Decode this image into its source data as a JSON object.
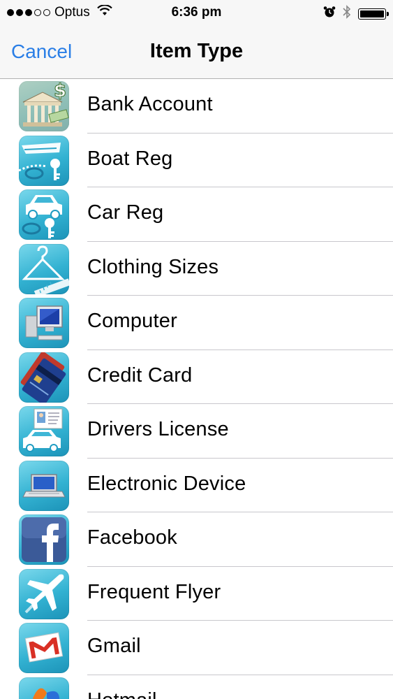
{
  "status_bar": {
    "carrier": "Optus",
    "signal_bars_filled": 3,
    "signal_bars_total": 5,
    "time": "6:36 pm",
    "icons": [
      "wifi-icon",
      "alarm-icon",
      "bluetooth-icon",
      "battery-icon"
    ]
  },
  "nav": {
    "cancel_label": "Cancel",
    "title": "Item Type",
    "accent_color": "#2a7ee6"
  },
  "items": [
    {
      "label": "Bank Account",
      "icon": "bank-icon"
    },
    {
      "label": "Boat Reg",
      "icon": "boat-key-icon"
    },
    {
      "label": "Car Reg",
      "icon": "car-key-icon"
    },
    {
      "label": "Clothing Sizes",
      "icon": "hanger-icon"
    },
    {
      "label": "Computer",
      "icon": "computer-icon"
    },
    {
      "label": "Credit Card",
      "icon": "credit-card-icon"
    },
    {
      "label": "Drivers License",
      "icon": "drivers-license-icon"
    },
    {
      "label": "Electronic Device",
      "icon": "laptop-icon"
    },
    {
      "label": "Facebook",
      "icon": "facebook-icon"
    },
    {
      "label": "Frequent Flyer",
      "icon": "airplane-icon"
    },
    {
      "label": "Gmail",
      "icon": "gmail-icon"
    },
    {
      "label": "Hotmail",
      "icon": "hotmail-icon"
    }
  ]
}
